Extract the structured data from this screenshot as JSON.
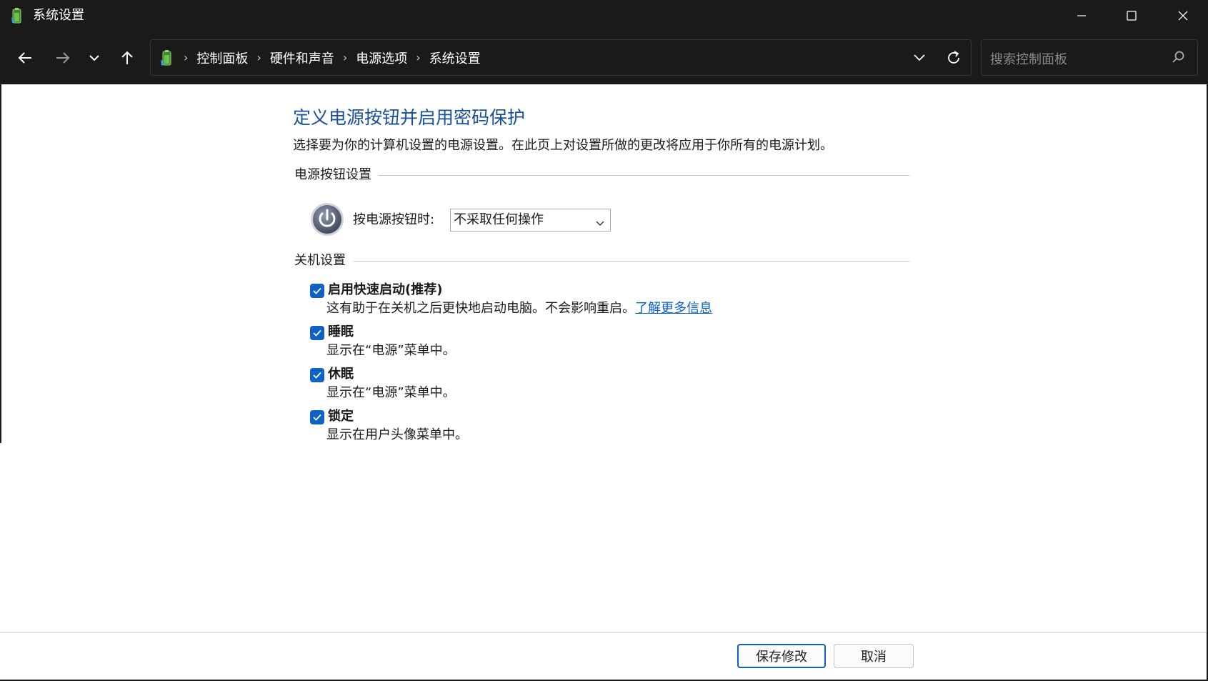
{
  "window": {
    "title": "系统设置",
    "controls": {
      "minimize_icon": "minimize-icon",
      "maximize_icon": "maximize-icon",
      "close_icon": "close-icon"
    }
  },
  "nav": {
    "back_icon": "back-arrow-icon",
    "forward_icon": "forward-arrow-icon",
    "recent_icon": "chevron-down-icon",
    "up_icon": "up-arrow-icon"
  },
  "address": {
    "breadcrumbs": [
      "控制面板",
      "硬件和声音",
      "电源选项",
      "系统设置"
    ],
    "separator": "›"
  },
  "search": {
    "placeholder": "搜索控制面板"
  },
  "main": {
    "heading": "定义电源按钮并启用密码保护",
    "description": "选择要为你的计算机设置的电源设置。在此页上对设置所做的更改将应用于你所有的电源计划。",
    "power_group_label": "电源按钮设置",
    "power_button_label": "按电源按钮时:",
    "power_button_value": "不采取任何操作",
    "shutdown_group_label": "关机设置",
    "options": [
      {
        "title": "启用快速启动(推荐)",
        "desc": "这有助于在关机之后更快地启动电脑。不会影响重启。",
        "link": "了解更多信息",
        "checked": true
      },
      {
        "title": "睡眠",
        "desc": "显示在“电源”菜单中。",
        "checked": true
      },
      {
        "title": "休眠",
        "desc": "显示在“电源”菜单中。",
        "checked": true
      },
      {
        "title": "锁定",
        "desc": "显示在用户头像菜单中。",
        "checked": true
      }
    ]
  },
  "footer": {
    "save_label": "保存修改",
    "cancel_label": "取消"
  },
  "colors": {
    "chrome": "#1c1a19",
    "heading": "#1a4f9c",
    "accent": "#0f62c3",
    "link": "#0a5fc8"
  }
}
